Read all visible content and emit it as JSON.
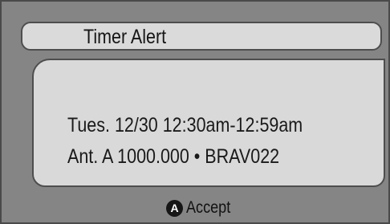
{
  "dialog": {
    "title": "Timer  Alert",
    "message": {
      "line1": "Tues. 12/30 12:30am-12:59am",
      "line2": "Ant. A 1000.000 • BRAV022"
    },
    "accept_button": {
      "icon_letter": "A",
      "label": "Accept"
    }
  },
  "colors": {
    "frame_background": "#858585",
    "panel_background": "#d9d9d9",
    "border": "#4e4e4e"
  }
}
